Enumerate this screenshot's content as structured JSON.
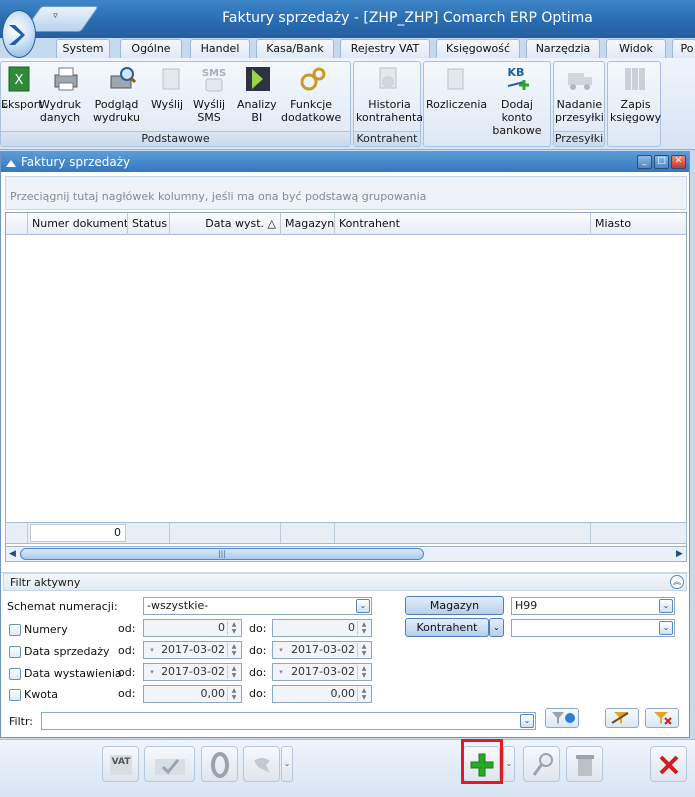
{
  "window": {
    "title": "Faktury sprzedaży - [ZHP_ZHP] Comarch ERP Optima"
  },
  "menu": {
    "tabs": [
      "System",
      "Ogólne",
      "Handel",
      "Kasa/Bank",
      "Rejestry VAT",
      "Księgowość",
      "Narzędzia",
      "Widok",
      "Po"
    ]
  },
  "ribbon": {
    "groups": {
      "podstawowe": "Podstawowe",
      "kontrahent": "Kontrahent",
      "przesylki": "Przesyłki"
    },
    "buttons": {
      "eksport": "Eksport",
      "wydruk": "Wydruk\ndanych",
      "podglad": "Podgląd\nwydruku",
      "wyslij": "Wyślij",
      "wyslij_sms": "Wyślij\nSMS",
      "analizy": "Analizy\nBI",
      "funkcje": "Funkcje\ndodatkowe",
      "historia": "Historia\nkontrahenta",
      "rozliczenia": "Rozliczenia",
      "dodaj_konto": "Dodaj konto\nbankowe",
      "nadanie": "Nadanie\nprzesyłki",
      "zapis": "Zapis\nksięgowy"
    },
    "icon_text": {
      "sms": "SMS",
      "kb": "KB"
    }
  },
  "document": {
    "title": "Faktury sprzedaży",
    "group_hint": "Przeciągnij tutaj nagłówek kolumny, jeśli ma ona być podstawą grupowania",
    "columns": [
      "Numer dokumentu",
      "Status",
      "Data wyst. △",
      "Magazyn",
      "Kontrahent",
      "Miasto"
    ],
    "footer_count": "0"
  },
  "filter": {
    "header": "Filtr aktywny",
    "schemat_label": "Schemat numeracji:",
    "schemat_value": "-wszystkie-",
    "magazyn_button": "Magazyn",
    "magazyn_value": "H99",
    "kontrahent_button": "Kontrahent",
    "kontrahent_value": "",
    "od": "od:",
    "do": "do:",
    "rows": [
      {
        "label": "Numery",
        "from": "0",
        "to": "0"
      },
      {
        "label": "Data sprzedaży",
        "from": "2017-03-02",
        "to": "2017-03-02"
      },
      {
        "label": "Data wystawienia",
        "from": "2017-03-02",
        "to": "2017-03-02"
      },
      {
        "label": "Kwota",
        "from": "0,00",
        "to": "0,00"
      }
    ],
    "filtr_label": "Filtr:",
    "filtr_value": ""
  },
  "bottom": {
    "vat_label": "VAT"
  },
  "colors": {
    "title_blue": "#2a6bb0",
    "highlight_red": "#e21c1c",
    "add_green": "#27a827",
    "close_red": "#d11f1f"
  }
}
